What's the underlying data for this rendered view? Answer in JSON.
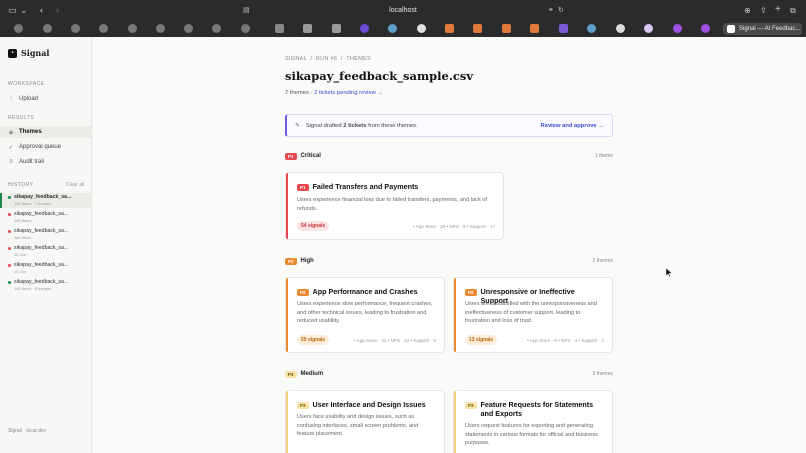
{
  "browser": {
    "url": "localhost",
    "active_tab_title": "Signal — AI Feedbac..."
  },
  "sidebar": {
    "brand": "Signal",
    "workspace_label": "WORKSPACE",
    "upload": "Upload",
    "results_label": "RESULTS",
    "themes": "Themes",
    "approval_queue": "Approval queue",
    "audit_trail": "Audit trail",
    "history_label": "HISTORY",
    "clear_all": "Clear all",
    "history": [
      {
        "name": "sikapay_feedback_sa...",
        "meta": "180 items · 7 themes"
      },
      {
        "name": "sikapay_feedback_sa...",
        "meta": "180 items"
      },
      {
        "name": "sikapay_feedback_sa...",
        "meta": "180 items"
      },
      {
        "name": "sikapay_feedback_sa...",
        "meta": "15 Jun"
      },
      {
        "name": "sikapay_feedback_sa...",
        "meta": "15 Jun"
      },
      {
        "name": "sikapay_feedback_sa...",
        "meta": "180 items · 8 themes"
      }
    ],
    "footer": "Signal · local dev"
  },
  "main": {
    "breadcrumb": "SIGNAL  /  RUN #6  /  THEMES",
    "title": "sikapay_feedback_sample.csv",
    "themes_count": "7 themes · ",
    "pending_link": "2 tickets pending review →",
    "banner": {
      "prefix": "Signal drafted ",
      "bold": "2 tickets",
      "suffix": " from these themes.",
      "action": "Review and approve →"
    },
    "sections": {
      "critical": {
        "badge": "P1",
        "label": "Critical",
        "count": "1 theme"
      },
      "high": {
        "badge": "P2",
        "label": "High",
        "count": "2 themes"
      },
      "medium": {
        "badge": "P3",
        "label": "Medium",
        "count": "3 themes"
      }
    },
    "cards": {
      "failed": {
        "badge": "P1",
        "title": "Failed Transfers and Payments",
        "desc": "Users experience financial loss due to failed transfers, payments, and lack of refunds.",
        "signals": "54 signals",
        "sources": "• App Store · 29  • NPS · 8  • Support · 17"
      },
      "perf": {
        "badge": "P2",
        "title": "App Performance and Crashes",
        "desc": "Users experience slow performance, frequent crashes, and other technical issues, leading to frustration and reduced usability.",
        "signals": "50 signals",
        "sources": "• App Store · 31  • NPS · 10  • Support · 9"
      },
      "support": {
        "badge": "P2",
        "title": "Unresponsive or Ineffective Support",
        "desc": "Users are dissatisfied with the unresponsiveness and ineffectiveness of customer support, leading to frustration and loss of trust.",
        "signals": "13 signals",
        "sources": "• App Store · 6  • NPS · 4  • Support · 3"
      },
      "ui": {
        "badge": "P3",
        "title": "User Interface and Design Issues",
        "desc": "Users face usability and design issues, such as confusing interfaces, small screen problems, and feature placement."
      },
      "requests": {
        "badge": "P3",
        "title": "Feature Requests for Statements and Exports",
        "desc": "Users request features for exporting and generating statements in various formats for official and business purposes."
      }
    }
  },
  "colors": {
    "p1": "#e5484d",
    "p2": "#e88a2d",
    "p3": "#f6e3a6",
    "link": "#3b4fd4"
  }
}
